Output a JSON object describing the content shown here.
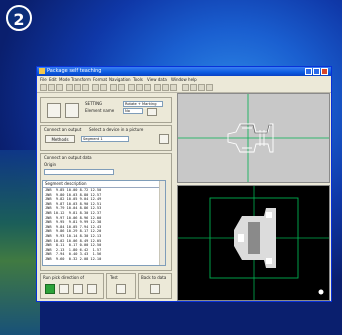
{
  "badge": {
    "number": "2"
  },
  "window": {
    "title": "Package self teaching"
  },
  "menu": [
    "File",
    "Edit",
    "Mode",
    "Transform",
    "Format",
    "Navigation",
    "Tools",
    "View data",
    "Window help"
  ],
  "left_panel": {
    "section_label": "SETTING",
    "field1_label": "Rotate + Marking",
    "field2_label": "Element name",
    "field2_value": "No",
    "output_label": "Connect an output",
    "source_label": "Select a device in a picture",
    "method_button": "Methods",
    "method_value": "Segment 1",
    "data_label": "Connect an output data",
    "origin_label": "Origin",
    "list_header": "Segment description",
    "rows": [
      "JNB  9.85 10.00 8.72 12.50",
      "JNB  9.80 10.03 8.80 12.57",
      "JNB  9.82 10.05 9.04 12.49",
      "JNB  9.87 10.03 8.90 12.51",
      "JNB  9.79 10.04 8.86 12.53",
      "JNB 10.12  9.81 8.30 12.37",
      "JNB  9.97 10.06 8.96 12.00",
      "JNB  9.95  9.81 9.99 12.38",
      "JNB  9.84 10.05 7.94 12.43",
      "JNB  9.86 10.29 8.17 12.20",
      "JNB  9.93 10.14 8.30 12.13",
      "JNB 10.02 10.06 8.49 12.05",
      "JNB  8.11  0.17 0.00 12.50",
      "JNB  2.13  1.80 6.42  1.57",
      "JNB  7.94  0.40 3.43  1.56",
      "JNB  9.60  0.32 2.08 12.10"
    ],
    "bottom_label": "Run pick direction of",
    "test_label": "Test",
    "save_label": "Back to data"
  },
  "colors": {
    "title_bar": "#0a5be0",
    "viewport_top_bg": "#c8c8c8",
    "viewport_bottom_bg": "#000000",
    "crosshair": "#00b050",
    "run_button": "#2ca23a"
  }
}
